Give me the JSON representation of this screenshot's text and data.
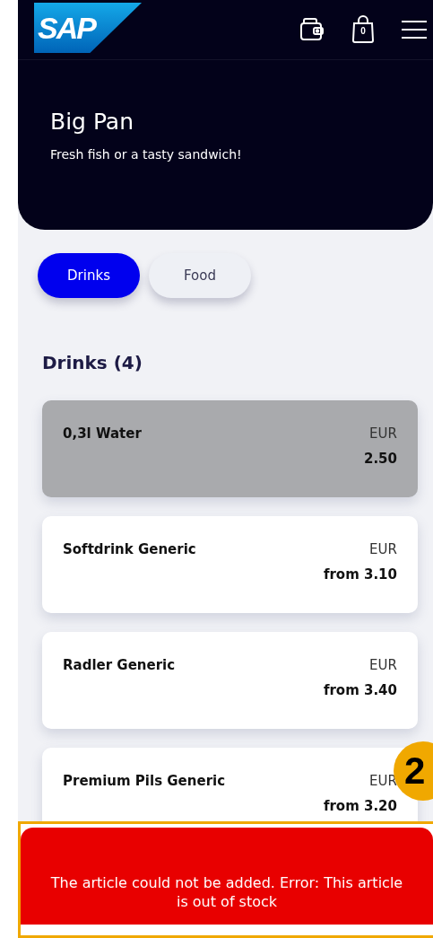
{
  "header": {
    "logo": "SAP",
    "cart_count": "0"
  },
  "hero": {
    "title": "Big Pan",
    "subtitle": "Fresh fish or a tasty sandwich!"
  },
  "tabs": [
    {
      "label": "Drinks",
      "selected": true
    },
    {
      "label": "Food",
      "selected": false
    }
  ],
  "section": {
    "title": "Drinks (4)"
  },
  "articles": [
    {
      "name": "0,3l Water",
      "currency": "EUR",
      "price": "2.50",
      "disabled": true
    },
    {
      "name": "Softdrink Generic",
      "currency": "EUR",
      "price": "from 3.10",
      "disabled": false
    },
    {
      "name": "Radler Generic",
      "currency": "EUR",
      "price": "from 3.40",
      "disabled": false
    },
    {
      "name": "Premium Pils Generic",
      "currency": "EUR",
      "price": "from 3.20",
      "disabled": false
    }
  ],
  "toast": {
    "message": "The article could not be added. Error: This article is out of stock"
  },
  "annotation": {
    "number": "2"
  }
}
